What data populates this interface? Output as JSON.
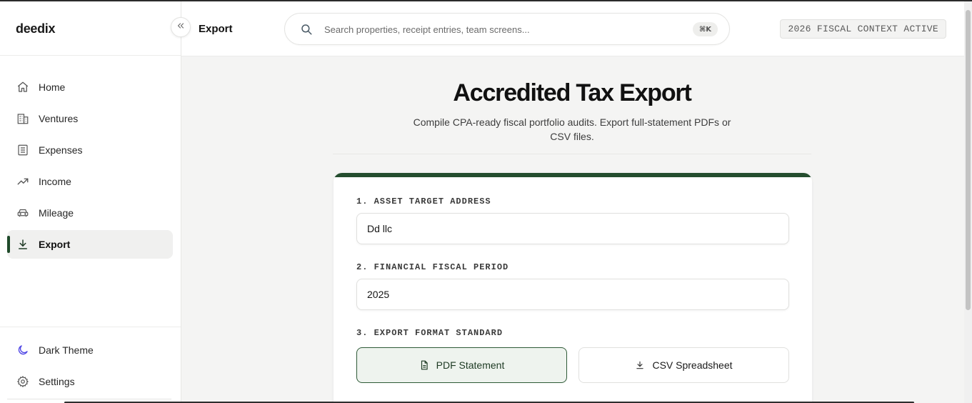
{
  "brand": "deedix",
  "header": {
    "page_title": "Export",
    "search_placeholder": "Search properties, receipt entries, team screens...",
    "shortcut": "⌘K",
    "fiscal_badge": "2026 FISCAL CONTEXT ACTIVE"
  },
  "sidebar": {
    "collapse_icon": "chevrons-left-icon",
    "items": [
      {
        "label": "Home",
        "icon": "home-icon"
      },
      {
        "label": "Ventures",
        "icon": "building-icon"
      },
      {
        "label": "Expenses",
        "icon": "receipt-icon"
      },
      {
        "label": "Income",
        "icon": "trending-up-icon"
      },
      {
        "label": "Mileage",
        "icon": "car-icon"
      },
      {
        "label": "Export",
        "icon": "download-icon",
        "active": true
      }
    ],
    "bottom_items": [
      {
        "label": "Dark Theme",
        "icon": "moon-icon"
      },
      {
        "label": "Settings",
        "icon": "gear-icon"
      }
    ]
  },
  "main": {
    "title": "Accredited Tax Export",
    "subtitle": "Compile CPA-ready fiscal portfolio audits. Export full-statement PDFs or CSV files.",
    "form": {
      "asset_label": "1. ASSET TARGET ADDRESS",
      "asset_value": "Dd llc",
      "period_label": "2. FINANCIAL FISCAL PERIOD",
      "period_value": "2025",
      "format_label": "3. EXPORT FORMAT STANDARD",
      "pdf_label": "PDF Statement",
      "csv_label": "CSV Spreadsheet",
      "selected_format": "PDF Statement"
    }
  },
  "colors": {
    "accent": "#244d2e",
    "moon_icon": "#4f46e5"
  }
}
